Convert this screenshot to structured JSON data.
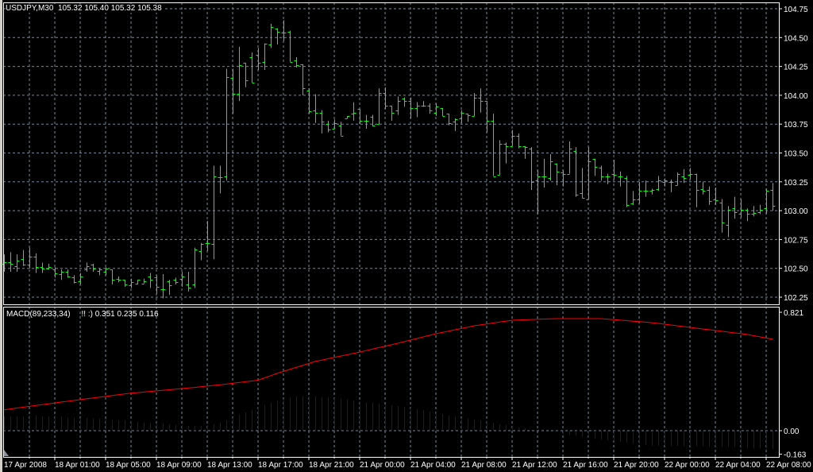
{
  "header": {
    "symbol": "USDJPY,M30",
    "open": "105.32",
    "high": "105.40",
    "low": "105.32",
    "close": "105.38"
  },
  "indicator": {
    "name": "MACD(89,233,34)",
    "values": "!! :) 0.351 0.235 0.116",
    "scale_labels": [
      "0.821",
      "0.00",
      "-0.163"
    ]
  },
  "colors": {
    "background": "#000000",
    "bars": "#00ff00",
    "grid": "#778899",
    "histogram": "#0000ff",
    "signal": "#ff0000",
    "axis_text": "#ffffff"
  },
  "chart_data": [
    {
      "type": "ohlc",
      "title": "USDJPY,M30",
      "ylim": [
        102.25,
        104.75
      ],
      "grid": true,
      "y_ticks": [
        "104.75",
        "104.50",
        "104.25",
        "104.00",
        "103.75",
        "103.50",
        "103.25",
        "103.00",
        "102.75",
        "102.50",
        "102.25"
      ],
      "x_tick_labels": [
        "17 Apr 2008",
        "18 Apr 01:00",
        "18 Apr 05:00",
        "18 Apr 09:00",
        "18 Apr 13:00",
        "18 Apr 17:00",
        "18 Apr 21:00",
        "21 Apr 00:00",
        "21 Apr 04:00",
        "21 Apr 08:00",
        "21 Apr 12:00",
        "21 Apr 16:00",
        "21 Apr 20:00",
        "22 Apr 00:00",
        "22 Apr 04:00",
        "22 Apr 08:00"
      ],
      "bar_interval_minutes": 30,
      "bars_ohlc": [
        [
          102.54,
          102.62,
          102.47,
          102.55
        ],
        [
          102.55,
          102.64,
          102.47,
          102.54
        ],
        [
          102.52,
          102.62,
          102.47,
          102.57
        ],
        [
          102.58,
          102.66,
          102.52,
          102.53
        ],
        [
          102.53,
          102.68,
          102.5,
          102.6
        ],
        [
          102.6,
          102.63,
          102.46,
          102.51
        ],
        [
          102.51,
          102.55,
          102.46,
          102.5
        ],
        [
          102.5,
          102.54,
          102.49,
          102.51
        ],
        [
          102.49,
          102.51,
          102.42,
          102.46
        ],
        [
          102.45,
          102.49,
          102.4,
          102.47
        ],
        [
          102.47,
          102.49,
          102.42,
          102.43
        ],
        [
          102.42,
          102.44,
          102.37,
          102.38
        ],
        [
          102.39,
          102.46,
          102.36,
          102.43
        ],
        [
          102.49,
          102.55,
          102.47,
          102.52
        ],
        [
          102.53,
          102.54,
          102.47,
          102.5
        ],
        [
          102.48,
          102.5,
          102.44,
          102.49
        ],
        [
          102.47,
          102.51,
          102.44,
          102.5
        ],
        [
          102.49,
          102.49,
          102.36,
          102.4
        ],
        [
          102.41,
          102.43,
          102.38,
          102.4
        ],
        [
          102.4,
          102.4,
          102.34,
          102.36
        ],
        [
          102.35,
          102.41,
          102.33,
          102.38
        ],
        [
          102.37,
          102.4,
          102.36,
          102.4
        ],
        [
          102.37,
          102.41,
          102.37,
          102.39
        ],
        [
          102.43,
          102.46,
          102.33,
          102.4
        ],
        [
          102.42,
          102.44,
          102.28,
          102.34
        ],
        [
          102.32,
          102.45,
          102.24,
          102.32
        ],
        [
          102.39,
          102.4,
          102.27,
          102.35
        ],
        [
          102.4,
          102.42,
          102.36,
          102.38
        ],
        [
          102.41,
          102.47,
          102.34,
          102.43
        ],
        [
          102.36,
          102.47,
          102.3,
          102.33
        ],
        [
          102.36,
          102.68,
          102.33,
          102.66
        ],
        [
          102.65,
          102.72,
          102.57,
          102.71
        ],
        [
          102.72,
          102.91,
          102.65,
          102.72
        ],
        [
          102.71,
          103.39,
          102.58,
          103.3
        ],
        [
          103.29,
          103.39,
          103.15,
          103.29
        ],
        [
          103.3,
          104.23,
          103.26,
          104.16
        ],
        [
          104.15,
          104.23,
          103.84,
          104.01
        ],
        [
          104.01,
          104.42,
          103.95,
          104.26
        ],
        [
          104.28,
          104.28,
          104.07,
          104.13
        ],
        [
          104.33,
          104.37,
          104.11,
          104.11
        ],
        [
          104.35,
          104.41,
          104.22,
          104.28
        ],
        [
          104.29,
          104.45,
          104.22,
          104.45
        ],
        [
          104.44,
          104.62,
          104.41,
          104.59
        ],
        [
          104.58,
          104.58,
          104.44,
          104.55
        ],
        [
          104.54,
          104.65,
          104.47,
          104.54
        ],
        [
          104.55,
          104.56,
          104.29,
          104.29
        ],
        [
          104.3,
          104.33,
          104.24,
          104.26
        ],
        [
          104.27,
          104.27,
          104.0,
          104.06
        ],
        [
          104.04,
          104.06,
          103.84,
          103.86
        ],
        [
          103.87,
          104.01,
          103.76,
          103.85
        ],
        [
          103.85,
          103.87,
          103.67,
          103.77
        ],
        [
          103.75,
          103.78,
          103.68,
          103.7
        ],
        [
          103.71,
          103.79,
          103.71,
          103.76
        ],
        [
          103.74,
          103.77,
          103.65,
          103.65
        ],
        [
          103.8,
          103.82,
          103.8,
          103.82
        ],
        [
          103.84,
          103.94,
          103.78,
          103.85
        ],
        [
          103.88,
          103.88,
          103.75,
          103.78
        ],
        [
          103.78,
          103.83,
          103.71,
          103.78
        ],
        [
          103.81,
          103.83,
          103.73,
          103.74
        ],
        [
          103.75,
          104.06,
          103.75,
          104.02
        ],
        [
          104.02,
          104.07,
          103.88,
          103.91
        ],
        [
          103.91,
          103.91,
          103.78,
          103.85
        ],
        [
          103.87,
          103.99,
          103.83,
          103.95
        ],
        [
          103.97,
          103.98,
          103.9,
          103.95
        ],
        [
          103.95,
          103.98,
          103.8,
          103.89
        ],
        [
          103.89,
          103.94,
          103.81,
          103.91
        ],
        [
          103.91,
          103.95,
          103.9,
          103.91
        ],
        [
          103.91,
          103.93,
          103.84,
          103.87
        ],
        [
          103.85,
          103.93,
          103.82,
          103.9
        ],
        [
          103.89,
          103.89,
          103.82,
          103.82
        ],
        [
          103.84,
          103.84,
          103.74,
          103.76
        ],
        [
          103.77,
          103.8,
          103.69,
          103.79
        ],
        [
          103.8,
          103.87,
          103.76,
          103.85
        ],
        [
          103.84,
          103.84,
          103.77,
          103.83
        ],
        [
          103.82,
          104.02,
          103.82,
          103.98
        ],
        [
          103.98,
          104.06,
          103.85,
          103.95
        ],
        [
          103.95,
          103.95,
          103.68,
          103.78
        ],
        [
          103.78,
          103.84,
          103.3,
          103.3
        ],
        [
          103.31,
          103.61,
          103.31,
          103.58
        ],
        [
          103.58,
          103.59,
          103.41,
          103.56
        ],
        [
          103.56,
          103.7,
          103.56,
          103.65
        ],
        [
          103.65,
          103.67,
          103.54,
          103.56
        ],
        [
          103.56,
          103.56,
          103.45,
          103.55
        ],
        [
          103.54,
          103.55,
          103.18,
          103.25
        ],
        [
          103.26,
          103.35,
          102.97,
          103.3
        ],
        [
          103.3,
          103.45,
          103.2,
          103.3
        ],
        [
          103.28,
          103.49,
          103.26,
          103.43
        ],
        [
          103.41,
          103.41,
          103.22,
          103.34
        ],
        [
          103.33,
          103.35,
          103.21,
          103.32
        ],
        [
          103.32,
          103.6,
          103.32,
          103.54
        ],
        [
          103.52,
          103.55,
          103.12,
          103.14
        ],
        [
          103.15,
          103.37,
          103.11,
          103.11
        ],
        [
          103.1,
          103.55,
          103.1,
          103.43
        ],
        [
          103.45,
          103.45,
          103.3,
          103.38
        ],
        [
          103.37,
          103.39,
          103.26,
          103.3
        ],
        [
          103.3,
          103.32,
          103.23,
          103.3
        ],
        [
          103.32,
          103.44,
          103.27,
          103.31
        ],
        [
          103.3,
          103.34,
          103.21,
          103.3
        ],
        [
          103.28,
          103.3,
          103.03,
          103.05
        ],
        [
          103.06,
          103.17,
          103.05,
          103.1
        ],
        [
          103.1,
          103.25,
          103.06,
          103.17
        ],
        [
          103.17,
          103.26,
          103.12,
          103.17
        ],
        [
          103.17,
          103.19,
          103.14,
          103.18
        ],
        [
          103.19,
          103.3,
          103.17,
          103.26
        ],
        [
          103.25,
          103.28,
          103.21,
          103.26
        ],
        [
          103.25,
          103.27,
          103.16,
          103.25
        ],
        [
          103.22,
          103.33,
          103.22,
          103.32
        ],
        [
          103.3,
          103.36,
          103.24,
          103.28
        ],
        [
          103.31,
          103.37,
          103.27,
          103.32
        ],
        [
          103.32,
          103.32,
          103.03,
          103.18
        ],
        [
          103.19,
          103.25,
          103.14,
          103.17
        ],
        [
          103.18,
          103.21,
          103.05,
          103.08
        ],
        [
          103.1,
          103.2,
          103.05,
          103.09
        ],
        [
          103.07,
          103.1,
          102.81,
          102.9
        ],
        [
          102.88,
          103.04,
          102.77,
          103.01
        ],
        [
          103.02,
          103.12,
          102.93,
          102.99
        ],
        [
          102.97,
          103.1,
          102.94,
          103.01
        ],
        [
          103.01,
          103.02,
          102.91,
          102.97
        ],
        [
          102.97,
          103.04,
          102.95,
          102.98
        ],
        [
          102.99,
          103.05,
          102.97,
          103.01
        ],
        [
          103.02,
          103.19,
          102.97,
          103.17
        ],
        [
          103.18,
          103.24,
          103.0,
          103.04
        ]
      ]
    },
    {
      "type": "bar+line",
      "title": "MACD(89,233,34)",
      "ylim": [
        -0.163,
        0.821
      ],
      "histogram": [
        0.099,
        0.099,
        0.099,
        0.099,
        0.107,
        0.107,
        0.099,
        0.099,
        0.103,
        0.099,
        0.094,
        0.094,
        0.09,
        0.088,
        0.084,
        0.084,
        0.081,
        0.075,
        0.072,
        0.072,
        0.068,
        0.062,
        0.057,
        0.053,
        0.053,
        0.05,
        0.044,
        0.04,
        0.039,
        0.035,
        0.033,
        0.033,
        0.039,
        0.044,
        0.057,
        0.072,
        0.09,
        0.112,
        0.127,
        0.145,
        0.165,
        0.178,
        0.197,
        0.208,
        0.22,
        0.23,
        0.239,
        0.239,
        0.239,
        0.239,
        0.233,
        0.233,
        0.228,
        0.224,
        0.217,
        0.211,
        0.206,
        0.198,
        0.195,
        0.189,
        0.182,
        0.176,
        0.171,
        0.165,
        0.162,
        0.149,
        0.143,
        0.132,
        0.127,
        0.116,
        0.105,
        0.097,
        0.088,
        0.083,
        0.077,
        0.072,
        0.068,
        0.055,
        0.044,
        0.039,
        0.031,
        0.022,
        0.017,
        0.006,
        0.002,
        0.0,
        -0.006,
        -0.011,
        -0.024,
        -0.029,
        -0.035,
        -0.044,
        -0.048,
        -0.057,
        -0.061,
        -0.066,
        -0.072,
        -0.077,
        -0.083,
        -0.09,
        -0.096,
        -0.099,
        -0.103,
        -0.103,
        -0.107,
        -0.107,
        -0.105,
        -0.108,
        -0.108,
        -0.107,
        -0.108,
        -0.112,
        -0.112,
        -0.112,
        -0.112,
        -0.116,
        -0.119,
        -0.119,
        -0.123,
        -0.123,
        -0.123,
        -0.127
      ],
      "signal_points": [
        [
          0,
          0.145
        ],
        [
          10,
          0.204
        ],
        [
          20,
          0.26
        ],
        [
          30,
          0.3
        ],
        [
          35,
          0.323
        ],
        [
          40,
          0.35
        ],
        [
          43,
          0.397
        ],
        [
          49,
          0.48
        ],
        [
          56,
          0.545
        ],
        [
          62,
          0.606
        ],
        [
          68,
          0.672
        ],
        [
          74,
          0.727
        ],
        [
          80,
          0.766
        ],
        [
          87,
          0.777
        ],
        [
          94,
          0.777
        ],
        [
          102,
          0.749
        ],
        [
          109,
          0.711
        ],
        [
          117,
          0.667
        ],
        [
          121,
          0.634
        ]
      ]
    }
  ]
}
